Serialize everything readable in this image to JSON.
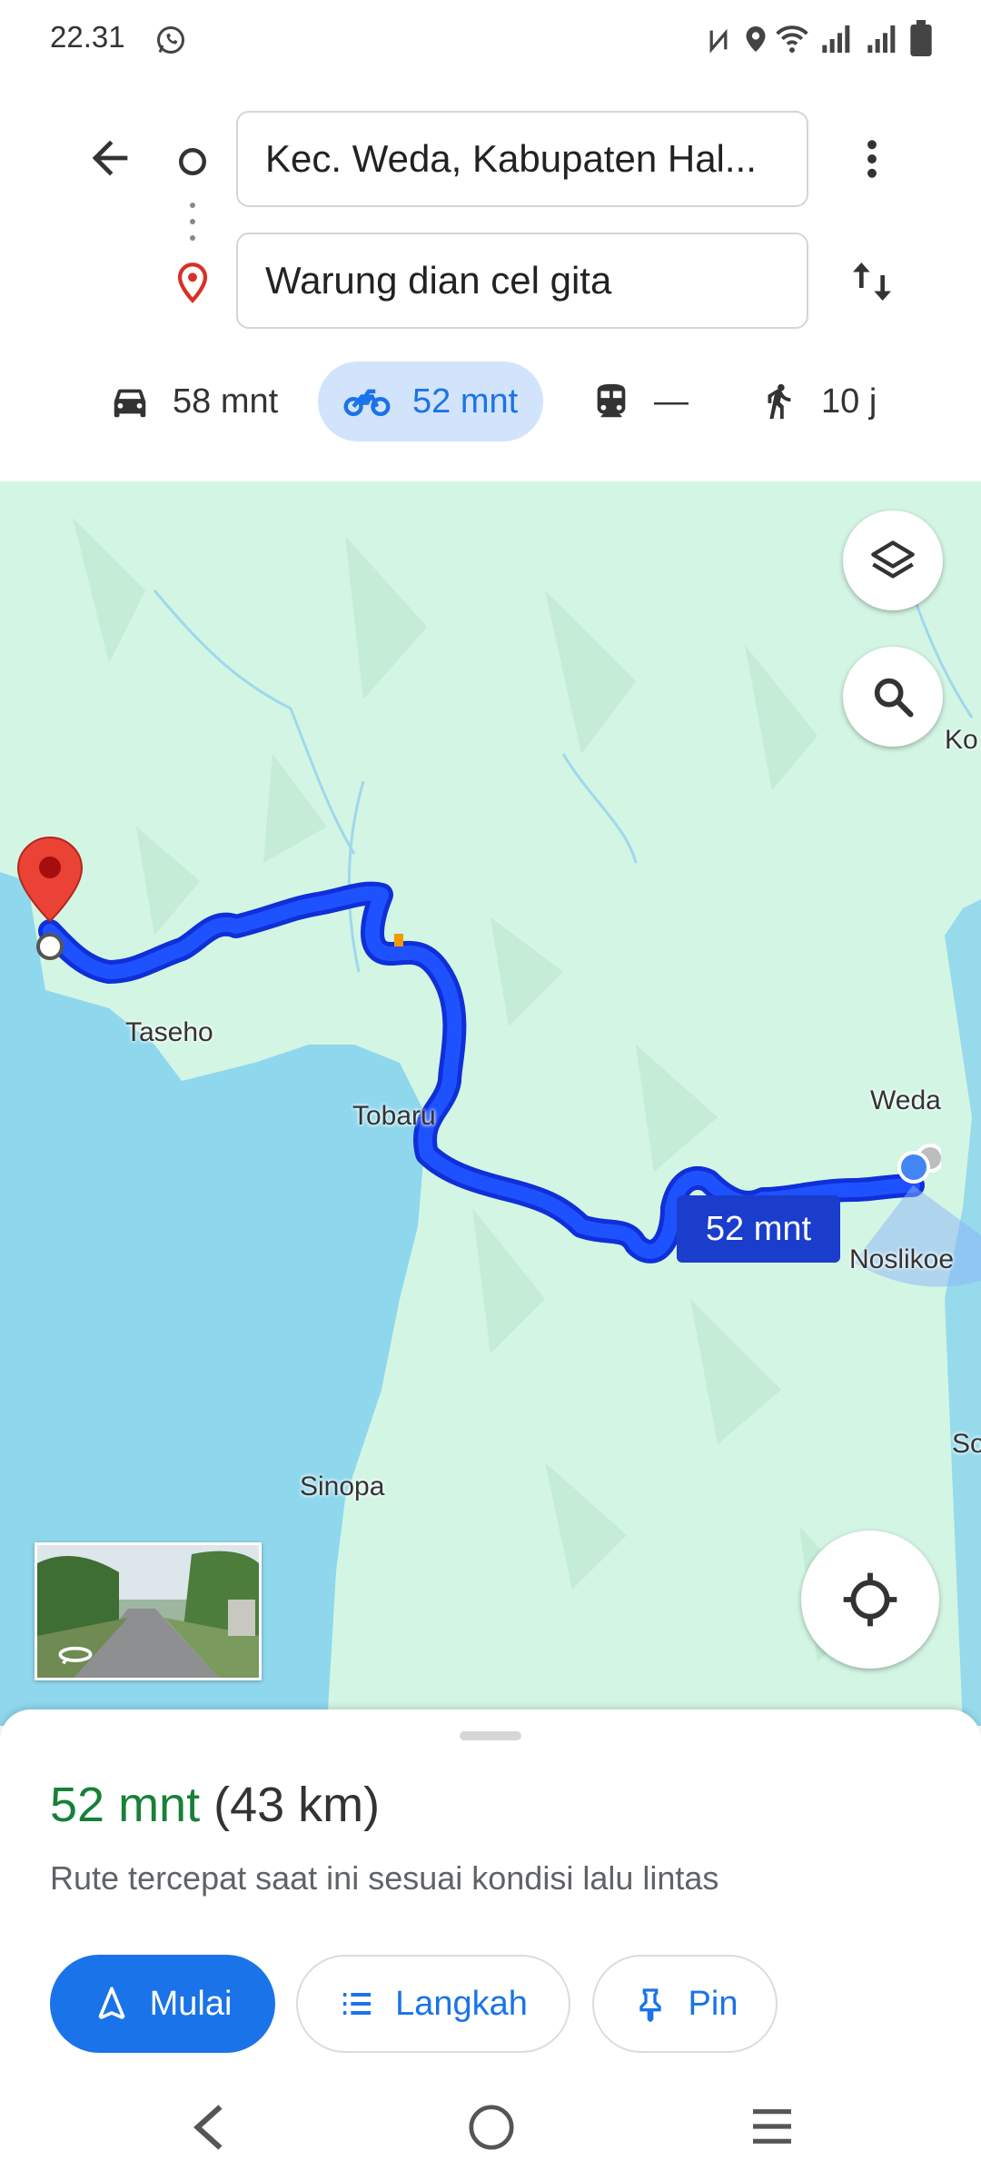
{
  "status": {
    "time": "22.31"
  },
  "header": {
    "origin": "Kec. Weda, Kabupaten Hal...",
    "destination": "Warung dian cel gita"
  },
  "modes": [
    {
      "icon": "car-icon",
      "label": "58 mnt",
      "selected": false
    },
    {
      "icon": "motorcycle-icon",
      "label": "52 mnt",
      "selected": true
    },
    {
      "icon": "transit-icon",
      "label": "—",
      "selected": false
    },
    {
      "icon": "walk-icon",
      "label": "10 j",
      "selected": false
    }
  ],
  "map": {
    "places": [
      "Taseho",
      "Tobaru",
      "Weda",
      "Noslikoe",
      "Sinopa",
      "Ko",
      "So"
    ],
    "route_badge": "52 mnt",
    "route_color": "#1a3dff"
  },
  "summary": {
    "duration": "52 mnt",
    "distance": "(43 km)",
    "description": "Rute tercepat saat ini sesuai kondisi lalu lintas"
  },
  "actions": {
    "start": "Mulai",
    "steps": "Langkah",
    "pin": "Pin"
  },
  "colors": {
    "accent": "#1a73e8",
    "green": "#188038",
    "water": "#8fd7ec",
    "land": "#d3f5e4"
  }
}
